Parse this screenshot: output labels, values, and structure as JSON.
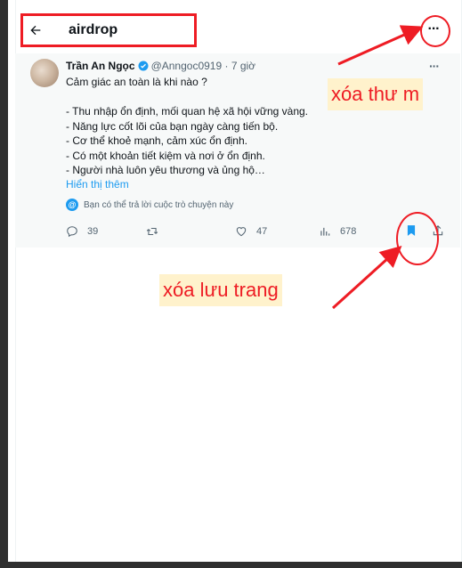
{
  "header": {
    "back_icon": "arrow-left-icon",
    "title": "airdrop",
    "more_icon": "more-horizontal-icon",
    "more_label": "···"
  },
  "tweet": {
    "author_name": "Trần An Ngọc",
    "verified_icon": "verified-badge-icon",
    "handle": "@Anngoc0919",
    "time": "· 7 giờ",
    "more_label": "···",
    "body": "Cảm giác an toàn là khi nào ?\n\n- Thu nhập ổn định, mối quan hệ xã hội vững vàng.\n- Năng lực cốt lõi của bạn ngày càng tiến bộ.\n- Cơ thể khoẻ mạnh, cảm xúc ổn định.\n- Có một khoản tiết kiệm và nơi ở ổn định.\n- Người nhà luôn yêu thương và ủng hộ…",
    "show_more": "Hiển thị thêm",
    "reply_note": "Bạn có thể trả lời cuộc trò chuyện này",
    "actions": {
      "reply_count": "39",
      "retweet_count": "",
      "like_count": "47",
      "views_count": "678"
    }
  },
  "annotations": {
    "delete_label": "xóa thư m",
    "unsave_label": "xóa lưu trang",
    "color": "#ee1c24",
    "label_bg": "#fff2cc"
  },
  "colors": {
    "accent": "#1d9bf0",
    "muted": "#536471",
    "tweet_bg": "#f7f9f9"
  }
}
